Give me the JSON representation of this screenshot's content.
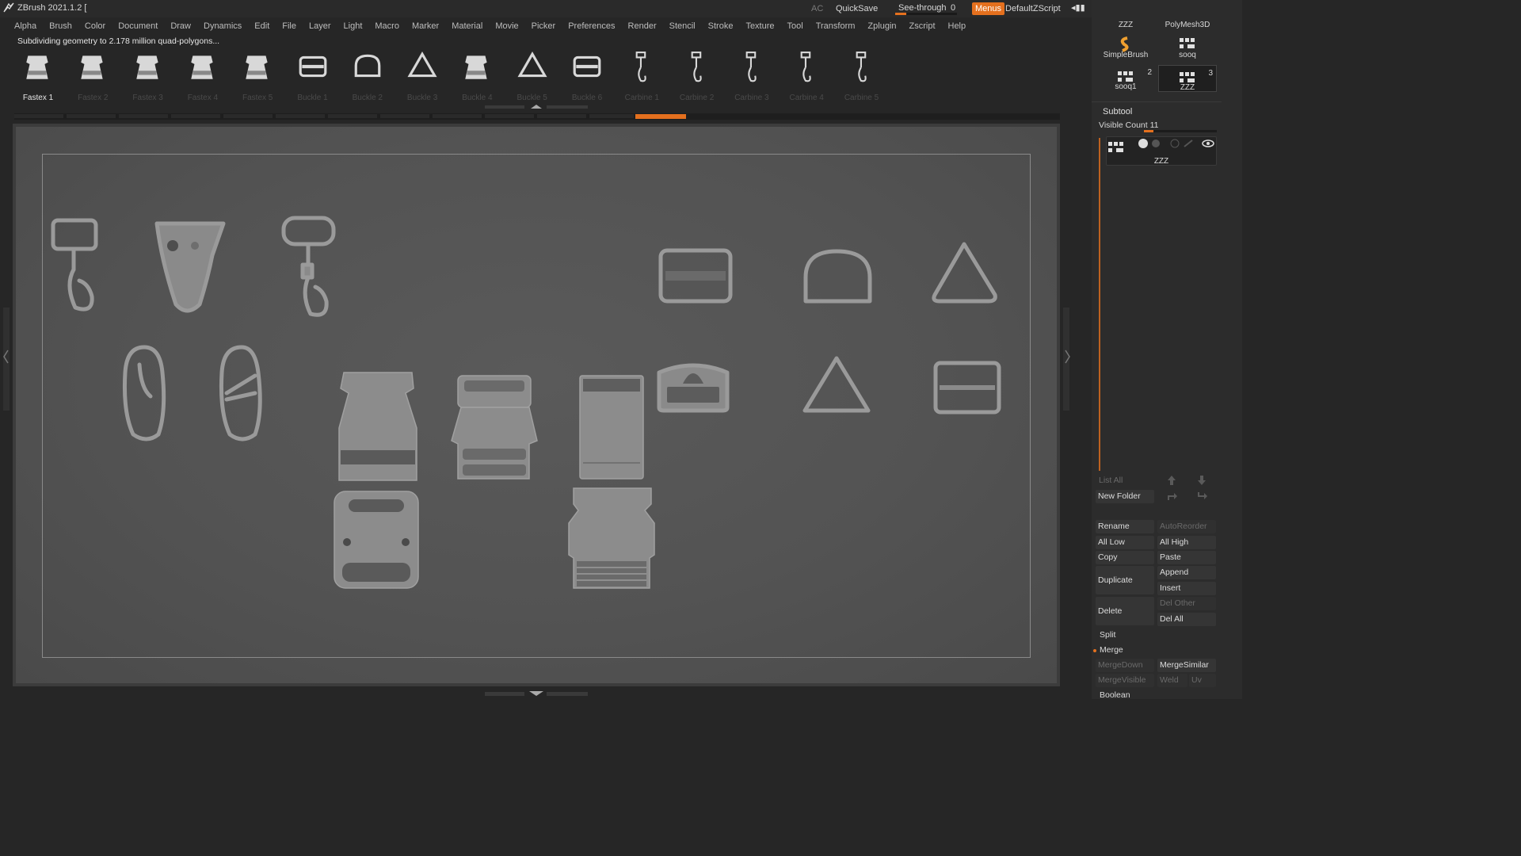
{
  "app": {
    "title": "ZBrush 2021.1.2 [",
    "ac_label": "AC",
    "quicksave_label": "QuickSave",
    "see_through_label": "See-through",
    "see_through_value": "0",
    "see_through_level": 0.18,
    "menus_label": "Menus",
    "script_label": "DefaultZScript"
  },
  "menubar": {
    "items": [
      "Alpha",
      "Brush",
      "Color",
      "Document",
      "Draw",
      "Dynamics",
      "Edit",
      "File",
      "Layer",
      "Light",
      "Macro",
      "Marker",
      "Material",
      "Movie",
      "Picker",
      "Preferences",
      "Render",
      "Stencil",
      "Stroke",
      "Texture",
      "Tool",
      "Transform",
      "Zplugin",
      "Zscript",
      "Help"
    ]
  },
  "status": {
    "text": "Subdividing geometry to 2.178 million quad-polygons..."
  },
  "shelf": {
    "items": [
      {
        "label": "Fastex 1",
        "icon": "buckle-icon",
        "active": true
      },
      {
        "label": "Fastex 2",
        "icon": "buckle-icon",
        "active": false
      },
      {
        "label": "Fastex 3",
        "icon": "buckle-icon",
        "active": false
      },
      {
        "label": "Fastex 4",
        "icon": "buckle-icon",
        "active": false
      },
      {
        "label": "Fastex 5",
        "icon": "buckle-icon",
        "active": false
      },
      {
        "label": "Buckle 1",
        "icon": "slider-buckle-icon",
        "active": false
      },
      {
        "label": "Buckle 2",
        "icon": "d-ring-icon",
        "active": false
      },
      {
        "label": "Buckle 3",
        "icon": "triangle-ring-icon",
        "active": false
      },
      {
        "label": "Buckle 4",
        "icon": "buckle-icon",
        "active": false
      },
      {
        "label": "Buckle 5",
        "icon": "triangle-ring-icon",
        "active": false
      },
      {
        "label": "Buckle 6",
        "icon": "slider-buckle-icon",
        "active": false
      },
      {
        "label": "Carbine 1",
        "icon": "carabiner-icon",
        "active": false
      },
      {
        "label": "Carbine 2",
        "icon": "carabiner-icon",
        "active": false
      },
      {
        "label": "Carbine 3",
        "icon": "carabiner-icon",
        "active": false
      },
      {
        "label": "Carbine 4",
        "icon": "carabiner-icon",
        "active": false
      },
      {
        "label": "Carbine 5",
        "icon": "carabiner-icon",
        "active": false
      }
    ]
  },
  "tool_palette": {
    "tools": [
      {
        "label": "ZZZ",
        "icon": "subtool-grid-icon",
        "count": ""
      },
      {
        "label": "PolyMesh3D",
        "icon": "polymesh-star-icon",
        "count": ""
      },
      {
        "label": "SimpleBrush",
        "icon": "simplebrush-icon",
        "count": ""
      },
      {
        "label": "sooq",
        "icon": "subtool-grid-icon",
        "count": ""
      },
      {
        "label": "sooq1",
        "icon": "subtool-grid-icon",
        "count": "2"
      },
      {
        "label": "ZZZ",
        "icon": "subtool-grid-icon",
        "count": "3"
      }
    ]
  },
  "subtool": {
    "header": "Subtool",
    "visible_count_label": "Visible Count 11",
    "visible_count_level": 0.13,
    "selected_name": "ZZZ",
    "list_all": "List All",
    "new_folder": "New Folder",
    "rename": "Rename",
    "auto_reorder": "AutoReorder",
    "all_low": "All Low",
    "all_high": "All High",
    "copy": "Copy",
    "paste": "Paste",
    "duplicate": "Duplicate",
    "append": "Append",
    "insert": "Insert",
    "delete": "Delete",
    "del_other": "Del Other",
    "del_all": "Del All",
    "split": "Split",
    "merge": "Merge",
    "merge_down": "MergeDown",
    "merge_similar": "MergeSimilar",
    "merge_visible": "MergeVisible",
    "weld": "Weld",
    "uv": "Uv",
    "boolean": "Boolean"
  },
  "colors": {
    "accent": "#e4701e",
    "panel": "#2c2c2c",
    "canvas": "#555555",
    "model": "#8e8e8e"
  }
}
